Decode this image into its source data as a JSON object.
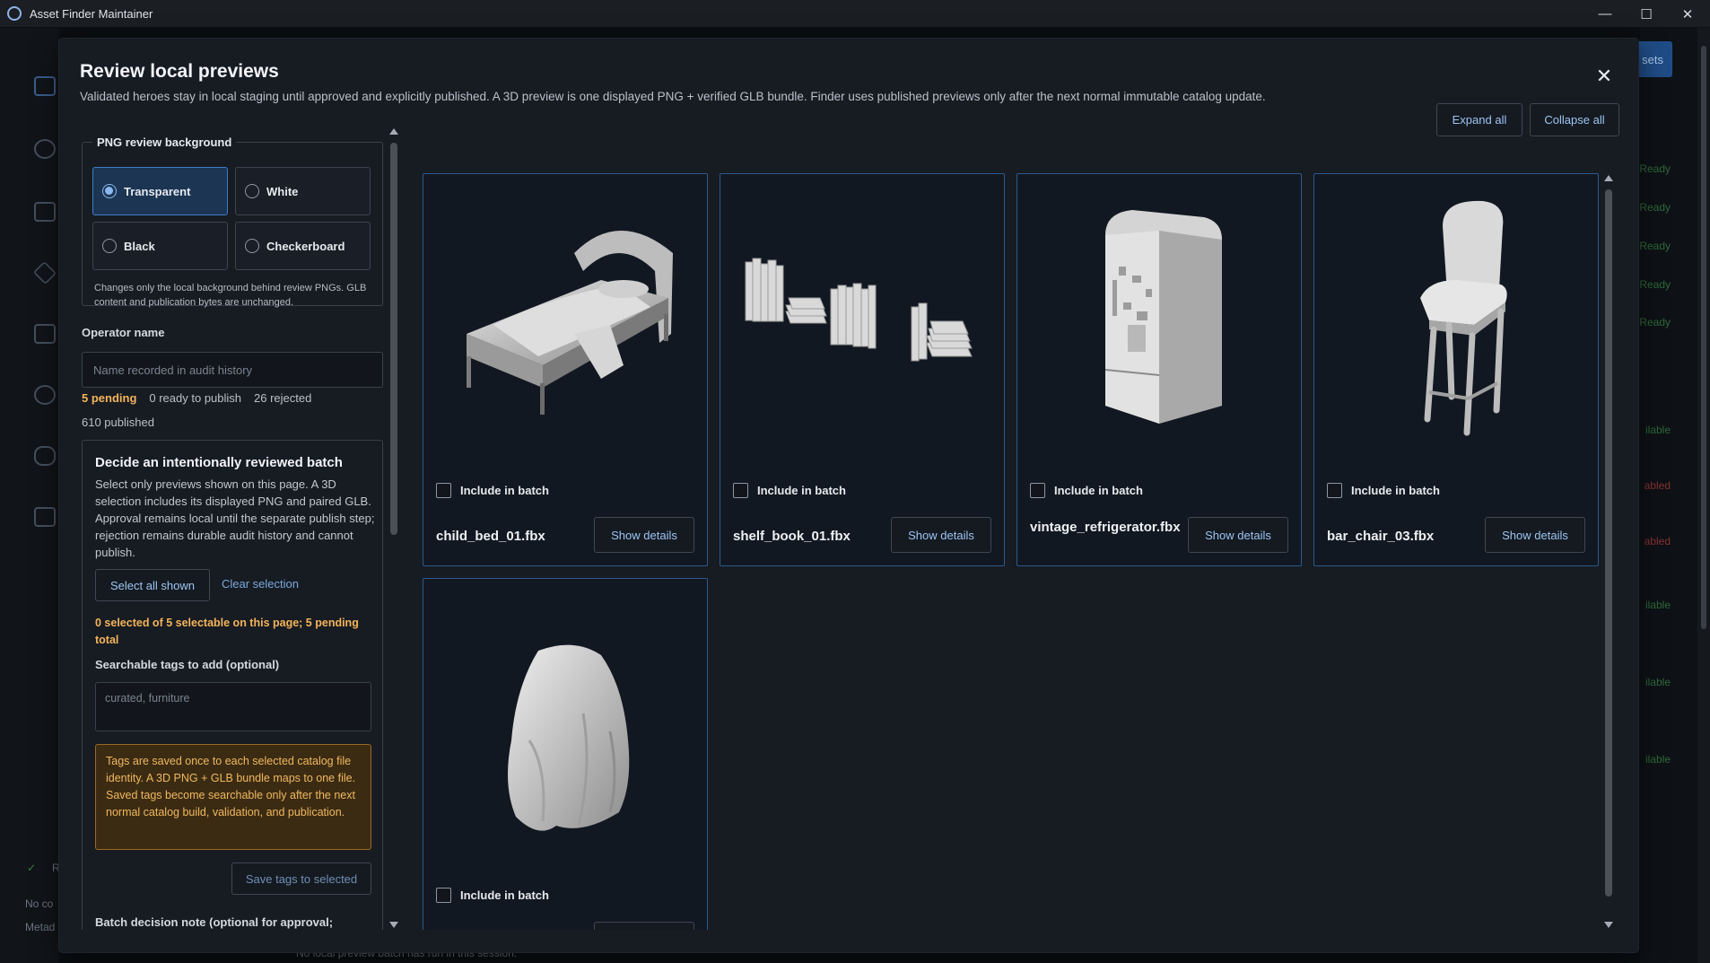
{
  "window": {
    "title": "Asset Finder Maintainer",
    "minimize_label": "—",
    "maximize_label": "☐",
    "close_label": "✕"
  },
  "background": {
    "top_button_label": "sets",
    "status_items": [
      "Ready",
      "Ready",
      "Ready",
      "Ready",
      "Ready",
      "ilable",
      "abled",
      "abled",
      "ilable",
      "ilable",
      "ilable"
    ],
    "status_colors": {
      "ready": "#3a7d44",
      "disabled": "#a23a3a",
      "available": "#3a7d44"
    },
    "bottom_text": "No local preview batch has run in this session.",
    "left_bottom_r": "R",
    "left_bottom_line1": "No co",
    "left_bottom_line2": "Metad"
  },
  "modal": {
    "title": "Review local previews",
    "subtitle": "Validated heroes stay in local staging until approved and explicitly published. A 3D preview is one displayed PNG + verified GLB bundle. Finder uses published previews only after the next normal immutable catalog update.",
    "close_label": "✕"
  },
  "background_picker": {
    "legend": "PNG review background",
    "options": [
      "Transparent",
      "White",
      "Black",
      "Checkerboard"
    ],
    "selected": "Transparent",
    "note": "Changes only the local background behind review PNGs. GLB content and publication bytes are unchanged."
  },
  "operator": {
    "label": "Operator name",
    "placeholder": "Name recorded in audit history",
    "value": ""
  },
  "counts": {
    "pending": "5 pending",
    "ready": "0 ready to publish",
    "rejected": "26 rejected",
    "published": "610 published"
  },
  "batch": {
    "title": "Decide an intentionally reviewed batch",
    "description": "Select only previews shown on this page. A 3D selection includes its displayed PNG and paired GLB. Approval remains local until the separate publish step; rejection remains durable audit history and cannot publish.",
    "select_all_label": "Select all shown",
    "clear_label": "Clear selection",
    "selection_info": "0 selected of 5 selectable on this page; 5 pending total",
    "tags_label": "Searchable tags to add (optional)",
    "tags_placeholder": "curated, furniture",
    "tags_warning": "Tags are saved once to each selected catalog file identity. A 3D PNG + GLB bundle maps to one file. Saved tags become searchable only after the next normal catalog build, validation, and publication.",
    "save_tags_label": "Save tags to selected",
    "note_label": "Batch decision note (optional for approval; required for rejection)"
  },
  "toolbar": {
    "expand_label": "Expand all",
    "collapse_label": "Collapse all"
  },
  "cards": [
    {
      "file": "child_bed_01.fbx",
      "include_label": "Include in batch",
      "details_label": "Show details",
      "checked": false,
      "preview_icon": "bed-preview"
    },
    {
      "file": "shelf_book_01.fbx",
      "include_label": "Include in batch",
      "details_label": "Show details",
      "checked": false,
      "preview_icon": "books-preview"
    },
    {
      "file": "vintage_refrigerator.fbx",
      "include_label": "Include in batch",
      "details_label": "Show details",
      "checked": false,
      "preview_icon": "fridge-preview"
    },
    {
      "file": "bar_chair_03.fbx",
      "include_label": "Include in batch",
      "details_label": "Show details",
      "checked": false,
      "preview_icon": "chair-preview"
    },
    {
      "file": "",
      "include_label": "Include in batch",
      "details_label": "",
      "checked": false,
      "preview_icon": "draped-cloth-preview"
    }
  ]
}
